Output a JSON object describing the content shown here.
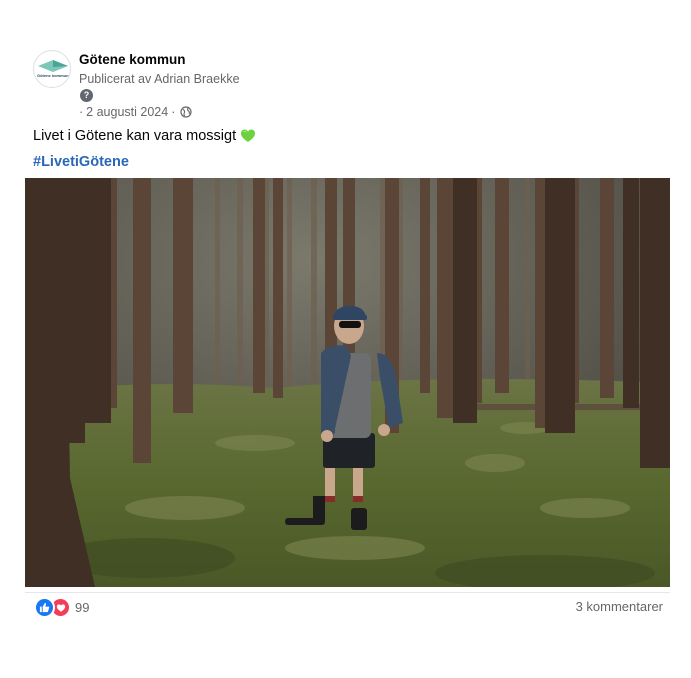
{
  "post": {
    "author": "Götene kommun",
    "avatar_text": "Götene kommun",
    "published_prefix": "Publicerat av",
    "publisher": "Adrian Braekke",
    "help_icon": "question-icon",
    "date_prefix": "·",
    "date": "2 augusti 2024",
    "date_suffix": "·",
    "audience_icon": "globe-icon",
    "text": "Livet i Götene kan vara mossigt",
    "emoji": "green-heart-icon",
    "hashtag": "#LivetiGötene",
    "image_icon": "forest-photo",
    "reactions": {
      "icons": [
        "like-icon",
        "love-icon"
      ],
      "count": "99"
    },
    "comments": "3 kommentarer",
    "colors": {
      "hashtag": "#2a67b7",
      "like": "#1877f2",
      "love": "#f33e58",
      "secondary_text": "#65676b",
      "heart": "#6ed13f"
    }
  }
}
